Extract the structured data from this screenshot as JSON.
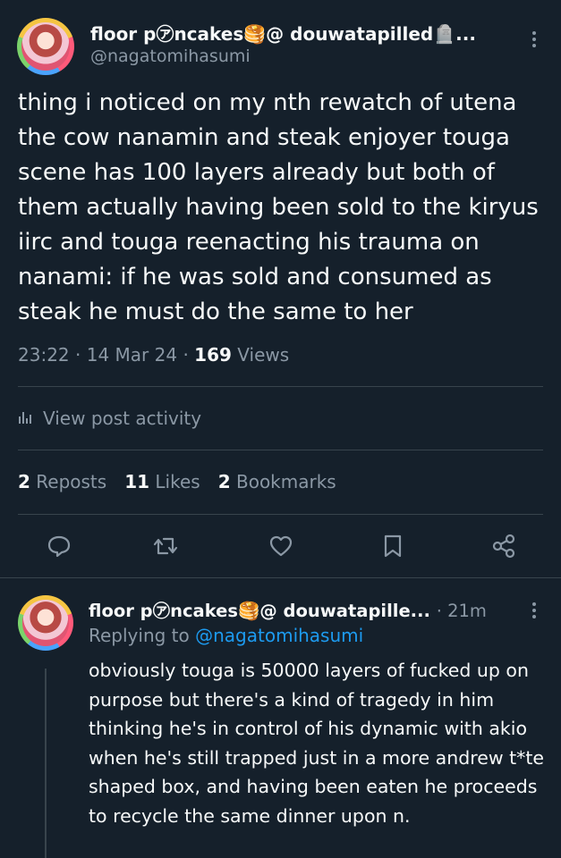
{
  "main_tweet": {
    "display_name": "floor p㋐ncakes🥞@ douwatapilled🪦...",
    "handle": "@nagatomihasumi",
    "text": "thing i noticed on my nth rewatch of utena the cow nanamin and steak enjoyer touga scene has 100 layers already but both of them actually having been sold to the kiryus iirc and touga reenacting his trauma on nanami: if he was sold and consumed as steak he must do the same to her",
    "time": "23:22",
    "sep": "·",
    "date": "14 Mar 24",
    "views_count": "169",
    "views_label": "Views",
    "activity_label": "View post activity",
    "reposts_count": "2",
    "reposts_label": "Reposts",
    "likes_count": "11",
    "likes_label": "Likes",
    "bookmarks_count": "2",
    "bookmarks_label": "Bookmarks"
  },
  "reply": {
    "display_name": "floor p㋐ncakes🥞@ douwatapille...",
    "time_ago": "· 21m",
    "replying_prefix": "Replying to",
    "replying_handle": "@nagatomihasumi",
    "text": "obviously touga is 50000 layers of fucked up on purpose but there's a kind of tragedy in him thinking he's in control of his dynamic with akio when he's still trapped just in a more andrew t*te shaped box, and having been eaten he proceeds to recycle the same dinner upon n."
  },
  "icons": [
    "more-icon",
    "analytics-icon",
    "reply-icon",
    "repost-icon",
    "like-icon",
    "bookmark-icon",
    "share-icon"
  ],
  "colors": {
    "background": "#15202b",
    "text": "#f7f9f9",
    "muted": "#8b98a5",
    "link": "#1d9bf0",
    "divider": "#38444d"
  }
}
